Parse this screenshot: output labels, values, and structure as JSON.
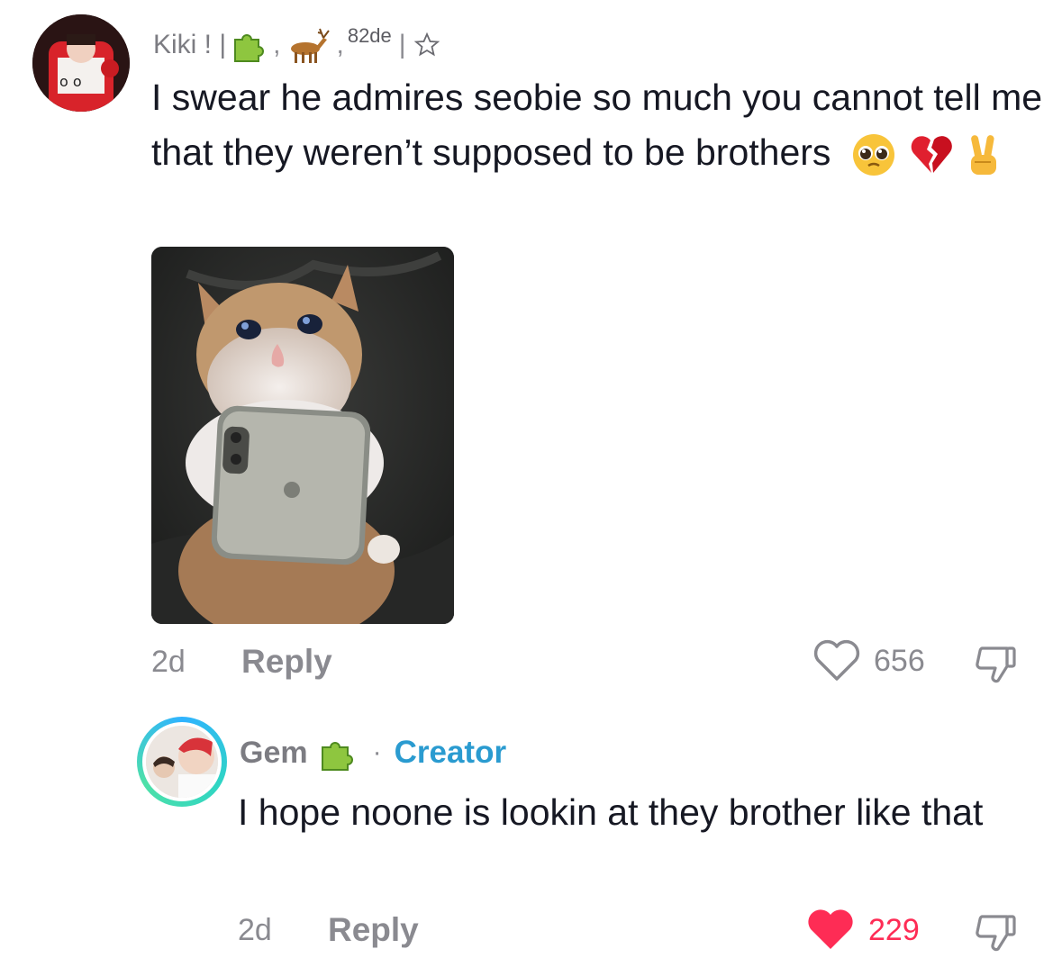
{
  "comments": [
    {
      "username": "Kiki ! |",
      "badge_suffix": "82de",
      "badge_separator": "|",
      "text": "I swear he admires seobie so much you cannot tell me that they weren’t supposed to be brothers",
      "emojis": [
        "pleading-face",
        "broken-heart",
        "victory-hand"
      ],
      "time": "2d",
      "reply_label": "Reply",
      "like_count": "656",
      "liked": false
    },
    {
      "username": "Gem",
      "role_separator": "·",
      "role": "Creator",
      "text": "I hope noone is lookin at they brother like that",
      "time": "2d",
      "reply_label": "Reply",
      "like_count": "229",
      "liked": true
    }
  ],
  "colors": {
    "like_active": "#fe2c55",
    "creator": "#2a9bd0",
    "muted": "#8a8a90",
    "text": "#161823"
  }
}
